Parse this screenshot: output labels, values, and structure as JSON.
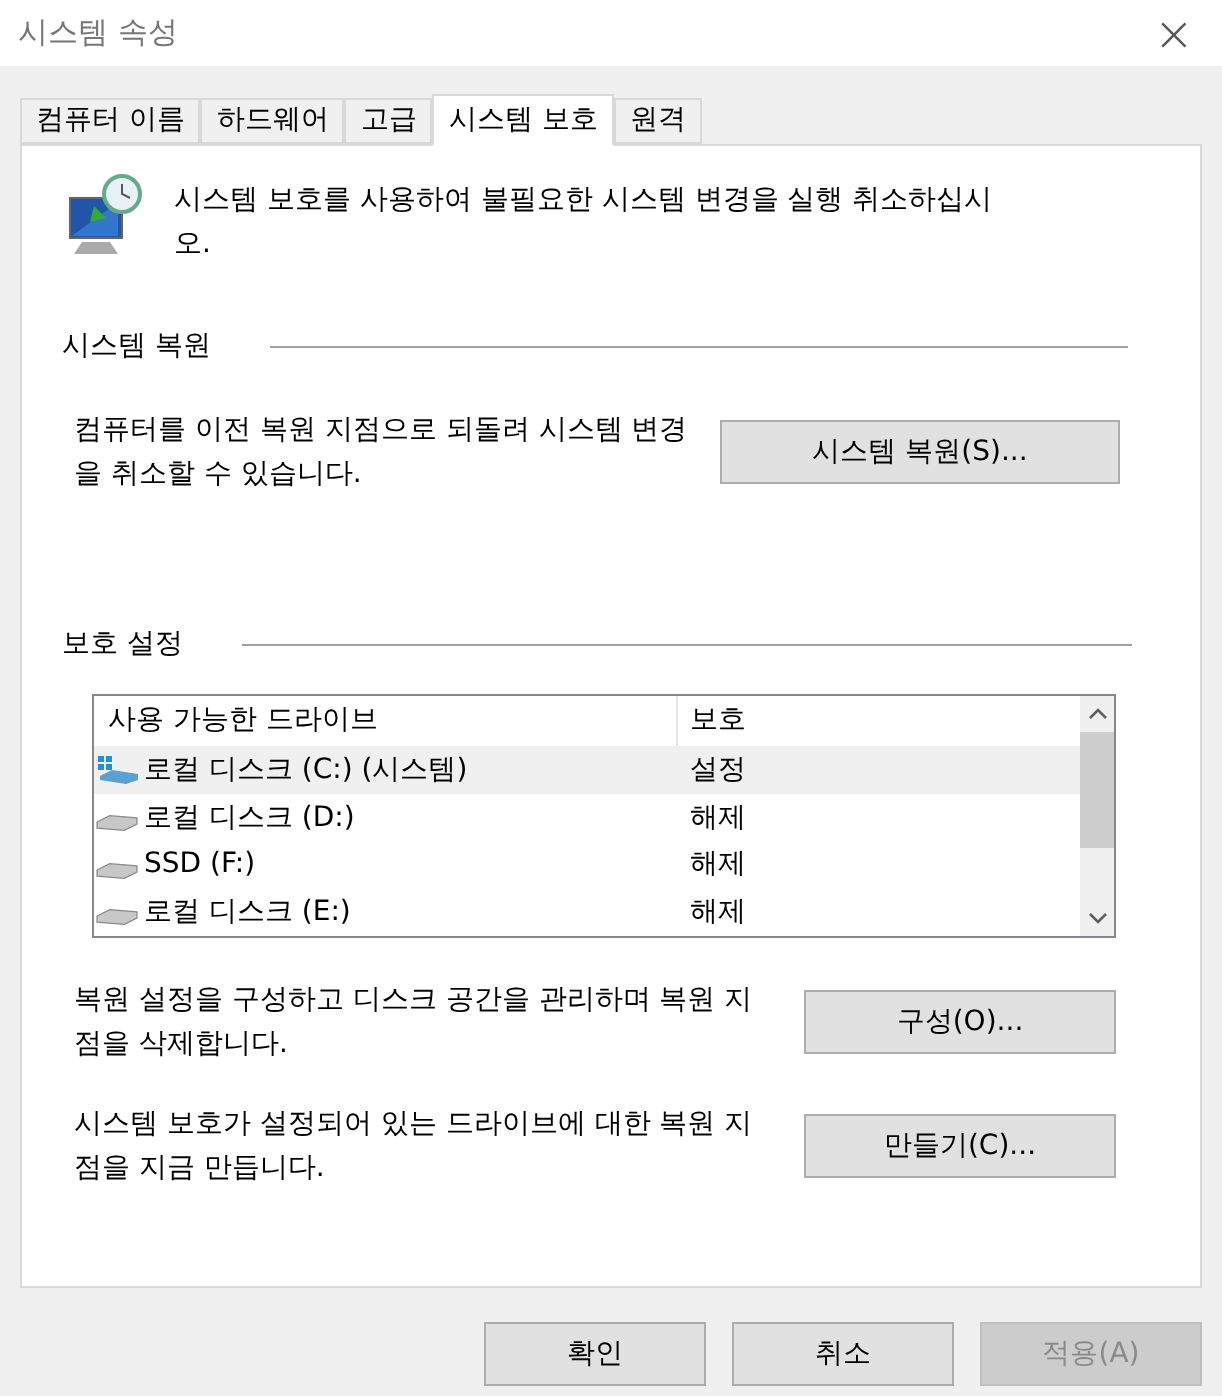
{
  "window": {
    "title": "시스템 속성",
    "close": "×"
  },
  "tabs": [
    {
      "label": "컴퓨터 이름",
      "selected": false
    },
    {
      "label": "하드웨어",
      "selected": false
    },
    {
      "label": "고급",
      "selected": false
    },
    {
      "label": "시스템 보호",
      "selected": true
    },
    {
      "label": "원격",
      "selected": false
    }
  ],
  "intro": "시스템 보호를 사용하여 불필요한 시스템 변경을 실행 취소하십시오.",
  "restore": {
    "heading": "시스템 복원",
    "text": "컴퓨터를 이전 복원 지점으로 되돌려 시스템 변경을 취소할 수 있습니다.",
    "button": "시스템 복원(S)..."
  },
  "protection": {
    "heading": "보호 설정",
    "columns": [
      "사용 가능한 드라이브",
      "보호"
    ],
    "rows": [
      {
        "kind": "system",
        "drive": "로컬 디스크 (C:) (시스템)",
        "status": "설정",
        "selected": true
      },
      {
        "kind": "drive",
        "drive": "로컬 디스크 (D:)",
        "status": "해제",
        "selected": false
      },
      {
        "kind": "drive",
        "drive": "SSD (F:)",
        "status": "해제",
        "selected": false
      },
      {
        "kind": "drive",
        "drive": "로컬 디스크 (E:)",
        "status": "해제",
        "selected": false
      }
    ],
    "configure_text": "복원 설정을 구성하고 디스크 공간을 관리하며 복원 지점을 삭제합니다.",
    "configure_button": "구성(O)...",
    "create_text": "시스템 보호가 설정되어 있는 드라이브에 대한 복원 지점을 지금 만듭니다.",
    "create_button": "만들기(C)..."
  },
  "buttons": [
    {
      "label": "확인",
      "disabled": false
    },
    {
      "label": "취소",
      "disabled": false
    },
    {
      "label": "적용(A)",
      "disabled": true
    }
  ]
}
